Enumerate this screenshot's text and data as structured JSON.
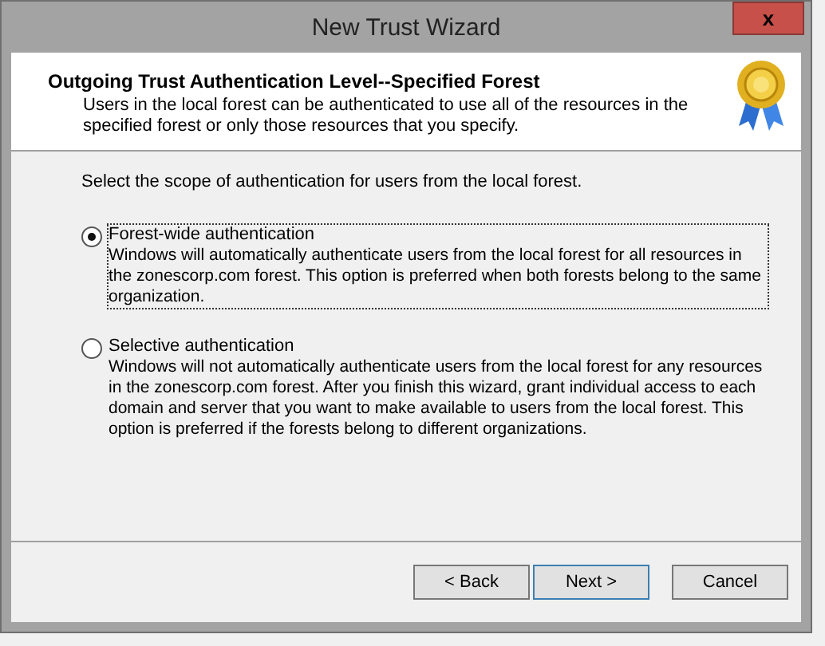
{
  "window": {
    "title": "New Trust Wizard",
    "close": "x"
  },
  "header": {
    "title": "Outgoing Trust Authentication Level--Specified Forest",
    "description": "Users in the local forest can be authenticated to use all of the resources in the specified forest or only those resources that you specify."
  },
  "prompt": "Select the scope of authentication for users from the local forest.",
  "options": [
    {
      "label": "Forest-wide authentication",
      "description": "Windows will automatically authenticate users from the local forest for all resources in the zonescorp.com forest. This option is preferred when both forests belong to the same organization.",
      "selected": true
    },
    {
      "label": "Selective authentication",
      "description": "Windows will not automatically authenticate users from the local forest for any resources in the zonescorp.com forest. After you finish this wizard, grant individual access to each domain and server that you want to make available to users from the local forest. This option is preferred if the forests belong to different organizations.",
      "selected": false
    }
  ],
  "buttons": [
    {
      "label": "< Back",
      "default": false
    },
    {
      "label": "Next >",
      "default": true
    },
    {
      "label": "Cancel",
      "default": false
    }
  ]
}
